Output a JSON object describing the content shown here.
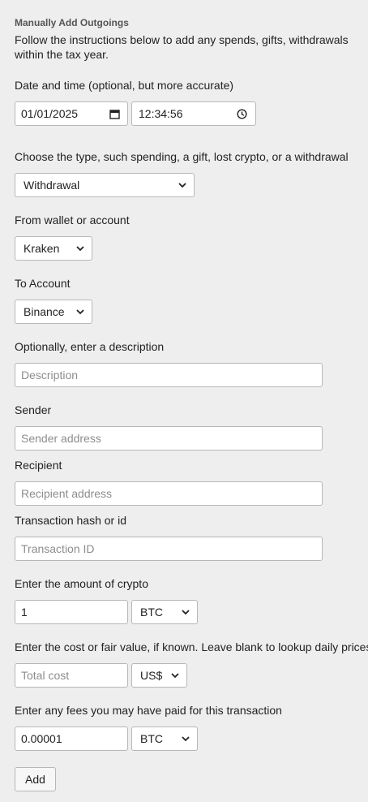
{
  "header": {
    "title": "Manually Add Outgoings",
    "intro": "Follow the instructions below to add any spends, gifts, withdrawals within the tax year."
  },
  "datetime": {
    "label": "Date and time (optional, but more accurate)",
    "date_value": "01/01/2025",
    "time_value": "12:34:56"
  },
  "type": {
    "label": "Choose the type, such spending, a gift, lost crypto, or a withdrawal",
    "selected": "Withdrawal"
  },
  "from_account": {
    "label": "From wallet or account",
    "selected": "Kraken"
  },
  "to_account": {
    "label": "To Account",
    "selected": "Binance"
  },
  "description": {
    "label": "Optionally, enter a description",
    "placeholder": "Description"
  },
  "sender": {
    "label": "Sender",
    "placeholder": "Sender address"
  },
  "recipient": {
    "label": "Recipient",
    "placeholder": "Recipient address"
  },
  "tx_hash": {
    "label": "Transaction hash or id",
    "placeholder": "Transaction ID"
  },
  "amount": {
    "label": "Enter the amount of crypto",
    "value": "1",
    "currency": "BTC"
  },
  "cost": {
    "label": "Enter the cost or fair value, if known. Leave blank to lookup daily prices.",
    "placeholder": "Total cost",
    "currency": "US$"
  },
  "fees": {
    "label": "Enter any fees you may have paid for this transaction",
    "value": "0.00001",
    "currency": "BTC"
  },
  "add_button": {
    "label": "Add"
  }
}
